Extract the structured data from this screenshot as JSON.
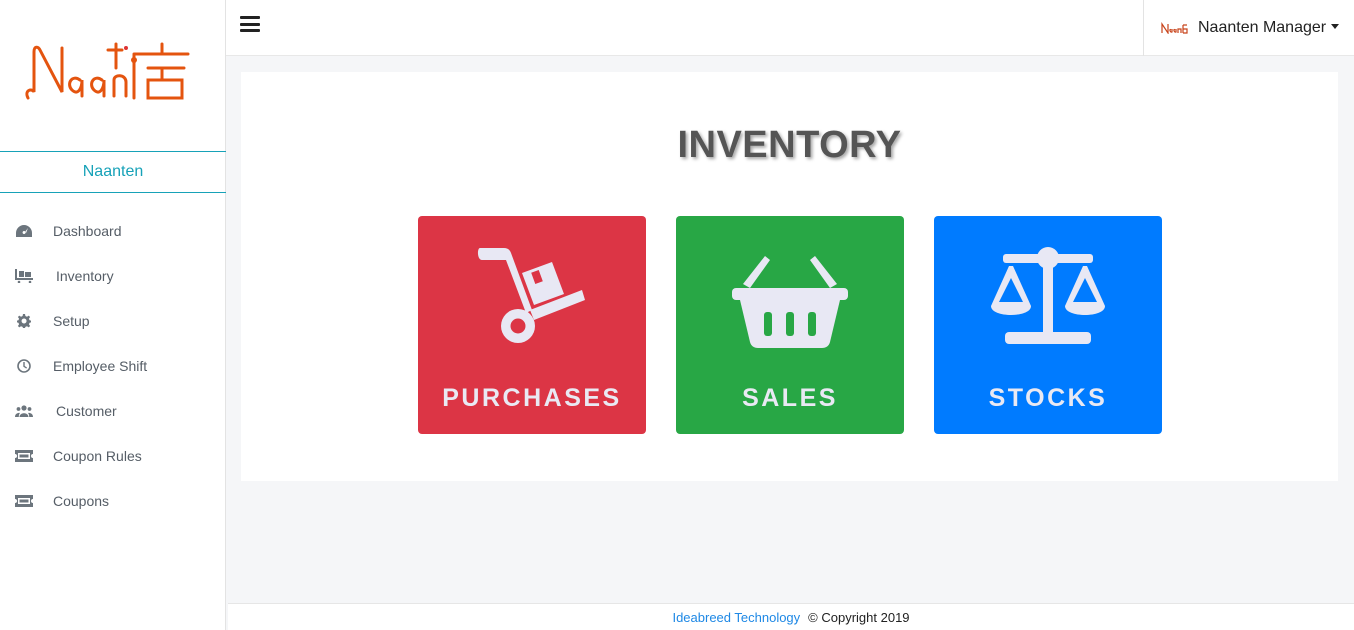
{
  "sidebar": {
    "logo_text": "Naan店",
    "brand": "Naanten",
    "items": [
      {
        "label": "Dashboard",
        "icon": "tachometer-icon"
      },
      {
        "label": "Inventory",
        "icon": "dolly-flatbed-icon"
      },
      {
        "label": "Setup",
        "icon": "gear-icon"
      },
      {
        "label": "Employee Shift",
        "icon": "clock-icon"
      },
      {
        "label": "Customer",
        "icon": "users-icon"
      },
      {
        "label": "Coupon Rules",
        "icon": "ticket-icon"
      },
      {
        "label": "Coupons",
        "icon": "ticket-icon"
      }
    ]
  },
  "topbar": {
    "menu_icon": "hamburger-icon",
    "user_name": "Naanten Manager"
  },
  "main": {
    "title": "INVENTORY",
    "tiles": [
      {
        "label": "PURCHASES",
        "icon": "dolly-icon",
        "color": "#dc3545"
      },
      {
        "label": "SALES",
        "icon": "shopping-basket-icon",
        "color": "#28a745"
      },
      {
        "label": "STOCKS",
        "icon": "balance-scale-icon",
        "color": "#007bff"
      }
    ]
  },
  "footer": {
    "company": "Ideabreed Technology",
    "copyright": "© Copyright 2019"
  },
  "colors": {
    "accent": "#17a2b8",
    "tile_text": "#e9e9f3"
  }
}
